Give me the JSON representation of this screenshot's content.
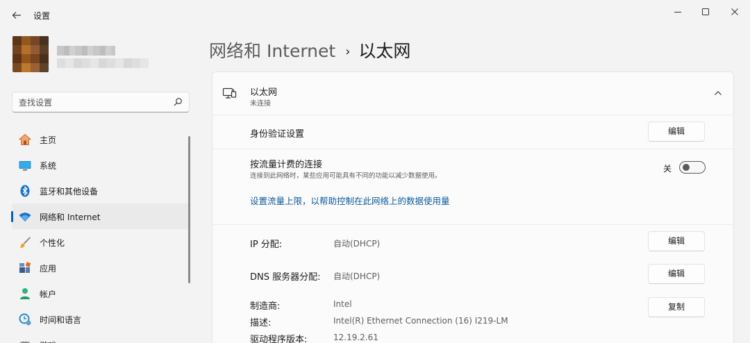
{
  "window": {
    "title": "设置",
    "controls": {
      "minimize_icon": "minimize-icon",
      "maximize_icon": "maximize-icon",
      "close_icon": "close-icon"
    }
  },
  "search": {
    "placeholder": "查找设置"
  },
  "sidebar": {
    "items": [
      {
        "label": "主页",
        "icon": "home-icon",
        "active": false
      },
      {
        "label": "系统",
        "icon": "system-icon",
        "active": false
      },
      {
        "label": "蓝牙和其他设备",
        "icon": "bluetooth-icon",
        "active": false
      },
      {
        "label": "网络和 Internet",
        "icon": "wifi-icon",
        "active": true
      },
      {
        "label": "个性化",
        "icon": "brush-icon",
        "active": false
      },
      {
        "label": "应用",
        "icon": "apps-icon",
        "active": false
      },
      {
        "label": "帐户",
        "icon": "account-icon",
        "active": false
      },
      {
        "label": "时间和语言",
        "icon": "time-language-icon",
        "active": false
      },
      {
        "label": "游戏",
        "icon": "gaming-icon",
        "active": false
      }
    ]
  },
  "breadcrumb": {
    "parent": "网络和 Internet",
    "separator": "›",
    "current": "以太网"
  },
  "ethernet": {
    "title": "以太网",
    "status": "未连接",
    "auth": {
      "label": "身份验证设置",
      "button": "编辑"
    },
    "metered": {
      "label": "按流量计费的连接",
      "description": "连接到此网络时，某些应用可能具有不同的功能以减少数据使用。",
      "state_label": "关",
      "on": false
    },
    "data_limit_link": "设置流量上限，以帮助控制在此网络上的数据使用量",
    "ip": {
      "label": "IP 分配:",
      "value": "自动(DHCP)",
      "button": "编辑"
    },
    "dns": {
      "label": "DNS 服务器分配:",
      "value": "自动(DHCP)",
      "button": "编辑"
    },
    "manufacturer": {
      "label": "制造商:",
      "value": "Intel"
    },
    "description": {
      "label": "描述:",
      "value": "Intel(R) Ethernet Connection (16) I219-LM"
    },
    "driver_version": {
      "label": "驱动程序版本:",
      "value": "12.19.2.61"
    },
    "copy_button": "复制"
  },
  "colors": {
    "accent": "#005fb8",
    "link": "#0a5a9c",
    "background": "#f3f3f3",
    "card": "#fbfbfb"
  }
}
